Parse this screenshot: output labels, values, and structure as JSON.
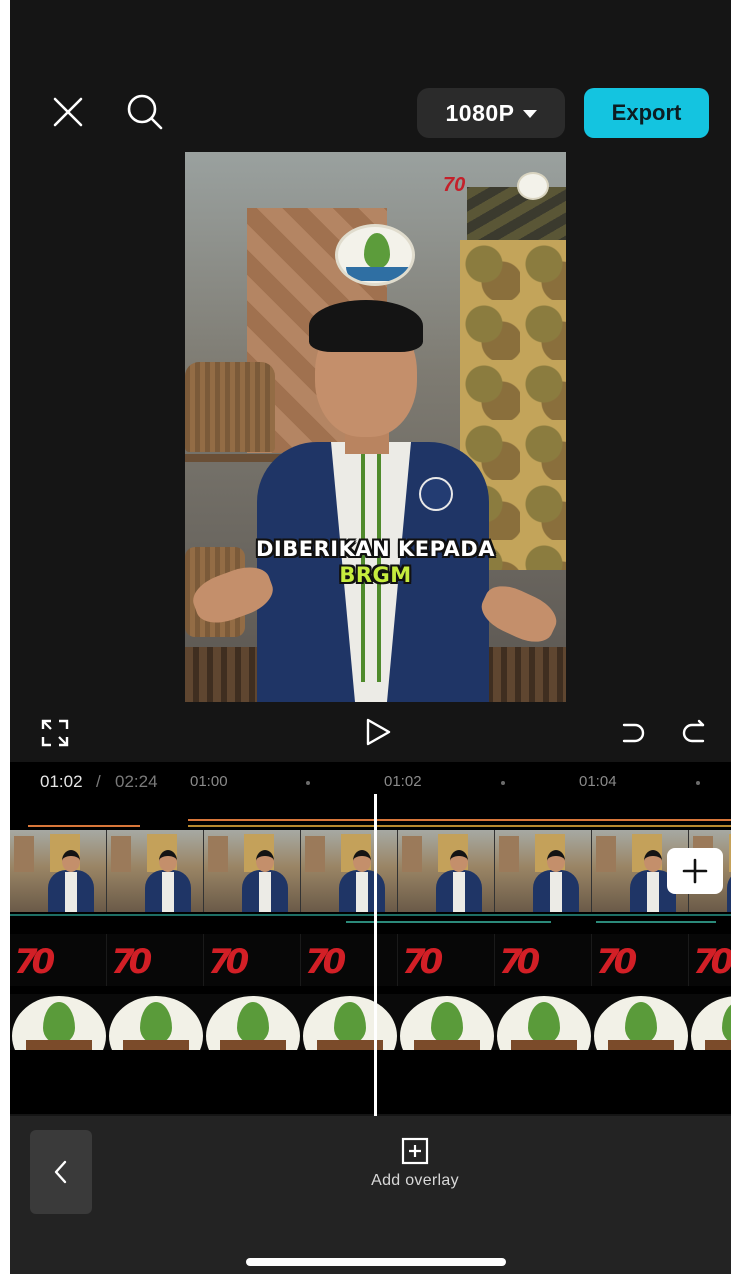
{
  "toolbar": {
    "resolution_label": "1080P",
    "export_label": "Export"
  },
  "preview": {
    "caption_line1": "DIBERIKAN KEPADA",
    "caption_line2": "BRGM",
    "corner_badge_text": "70"
  },
  "timeline": {
    "current_time": "01:02",
    "separator": "/",
    "total_time": "02:24",
    "ruler_labels": [
      "01:00",
      "01:02",
      "01:04"
    ]
  },
  "overlay_track": {
    "logo_text": "70"
  },
  "bottom_panel": {
    "add_overlay_label": "Add overlay"
  },
  "icons": [
    "close-icon",
    "search-icon",
    "chevron-down-icon",
    "fullscreen-icon",
    "play-icon",
    "undo-icon",
    "redo-icon",
    "plus-icon",
    "back-chevron-icon",
    "add-overlay-icon"
  ],
  "colors": {
    "export_accent": "#14c4e0",
    "caption_highlight": "#c6ec3e",
    "background": "#151515"
  }
}
